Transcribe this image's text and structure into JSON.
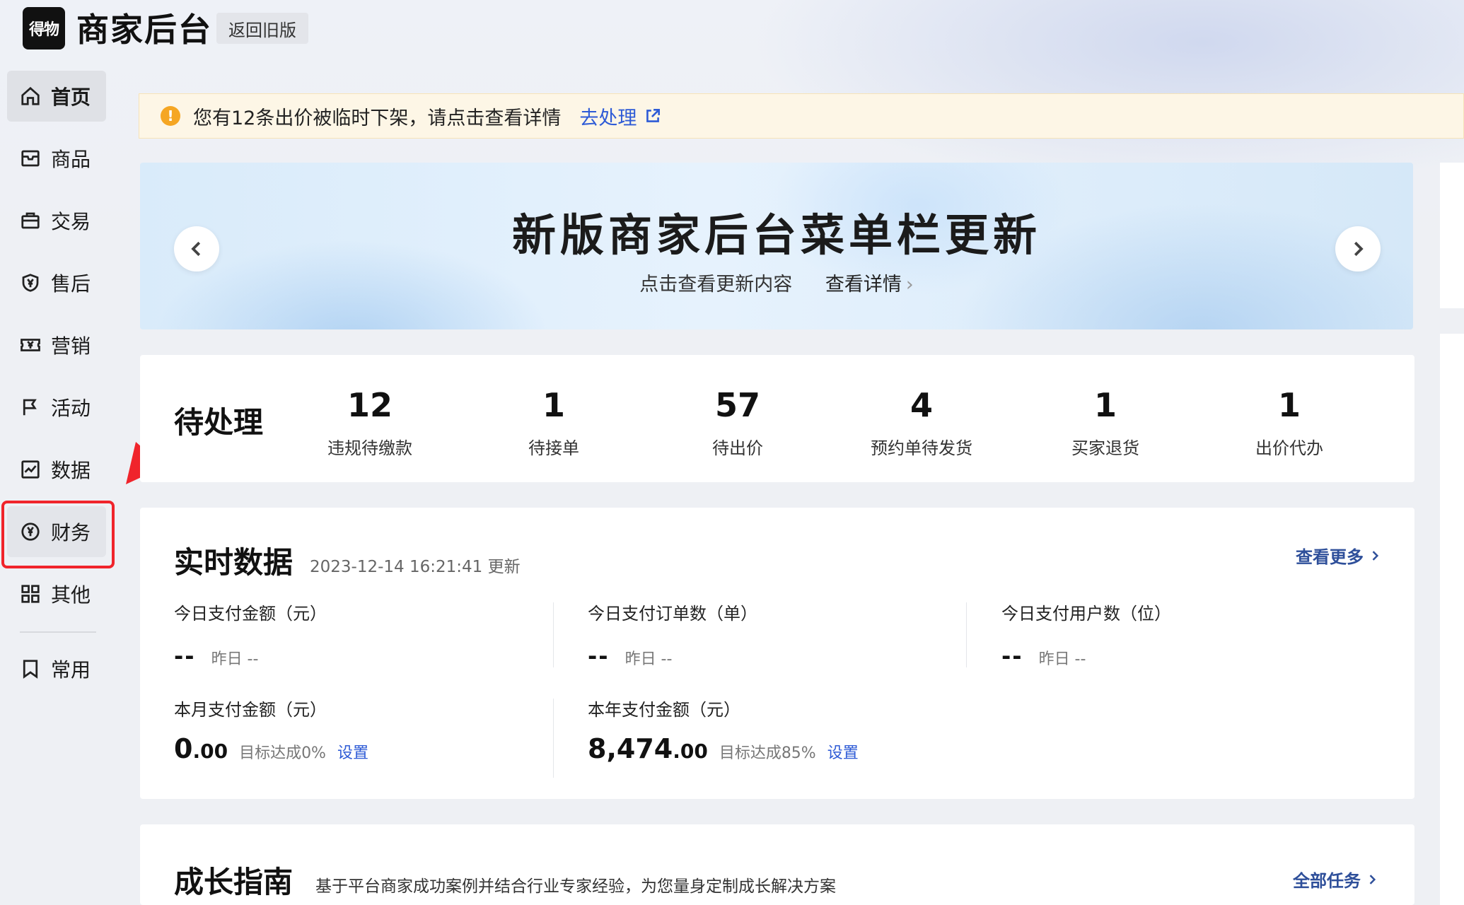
{
  "header": {
    "logo_text": "得物",
    "title": "商家后台",
    "back_label": "返回旧版"
  },
  "sidebar": {
    "items": [
      {
        "label": "首页",
        "icon": "home-icon"
      },
      {
        "label": "商品",
        "icon": "inbox-icon"
      },
      {
        "label": "交易",
        "icon": "bag-icon"
      },
      {
        "label": "售后",
        "icon": "shield-yen-icon"
      },
      {
        "label": "营销",
        "icon": "ticket-yen-icon"
      },
      {
        "label": "活动",
        "icon": "flag-icon"
      },
      {
        "label": "数据",
        "icon": "chart-icon"
      },
      {
        "label": "财务",
        "icon": "yen-circle-icon"
      },
      {
        "label": "其他",
        "icon": "grid-icon"
      },
      {
        "label": "常用",
        "icon": "bookmark-icon"
      }
    ],
    "active": "首页",
    "highlighted": "财务",
    "highlight_color": "#f0242b"
  },
  "notice": {
    "text": "您有12条出价被临时下架，请点击查看详情",
    "link_label": "去处理",
    "icon": "warning-icon",
    "accent": "#f5a623"
  },
  "banner": {
    "title": "新版商家后台菜单栏更新",
    "subtitle": "点击查看更新内容",
    "detail_label": "查看详情"
  },
  "pending": {
    "title": "待处理",
    "stats": [
      {
        "value": "12",
        "label": "违规待缴款"
      },
      {
        "value": "1",
        "label": "待接单"
      },
      {
        "value": "57",
        "label": "待出价"
      },
      {
        "value": "4",
        "label": "预约单待发货"
      },
      {
        "value": "1",
        "label": "买家退货"
      },
      {
        "value": "1",
        "label": "出价代办"
      }
    ]
  },
  "realtime": {
    "title": "实时数据",
    "updated": "2023-12-14 16:21:41 更新",
    "more_label": "查看更多",
    "today": [
      {
        "label": "今日支付金额（元）",
        "value": "--",
        "yesterday": "昨日 --"
      },
      {
        "label": "今日支付订单数（单）",
        "value": "--",
        "yesterday": "昨日 --"
      },
      {
        "label": "今日支付用户数（位）",
        "value": "--",
        "yesterday": "昨日 --"
      }
    ],
    "period": [
      {
        "label": "本月支付金额（元）",
        "int": "0",
        "dec": ".00",
        "goal": "目标达成0%",
        "set_label": "设置"
      },
      {
        "label": "本年支付金额（元）",
        "int": "8,474",
        "dec": ".00",
        "goal": "目标达成85%",
        "set_label": "设置"
      }
    ]
  },
  "growth": {
    "title": "成长指南",
    "desc": "基于平台商家成功案例并结合行业专家经验，为您量身定制成长解决方案",
    "more_label": "全部任务"
  }
}
